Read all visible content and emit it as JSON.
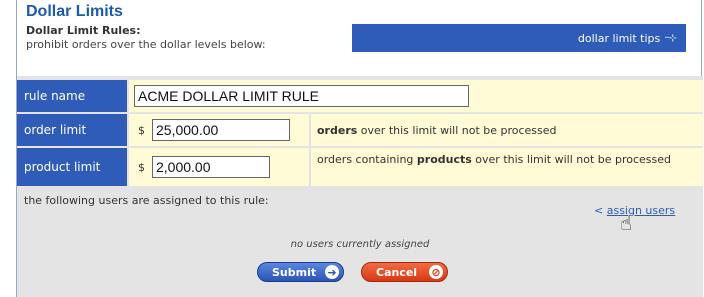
{
  "header": {
    "title": "Dollar Limits",
    "subtitle": "Dollar Limit Rules:",
    "description": "prohibit orders over the dollar levels below:",
    "tips_label": "dollar limit tips",
    "tips_icon": "dots-arrow-icon"
  },
  "form": {
    "rule_name": {
      "label": "rule name",
      "value": "ACME DOLLAR LIMIT RULE"
    },
    "order_limit": {
      "label": "order limit",
      "currency": "$",
      "value": "25,000.00",
      "note_bold": "orders",
      "note_rest": " over this limit will not be processed"
    },
    "product_limit": {
      "label": "product limit",
      "currency": "$",
      "value": "2,000.00",
      "note_pre": "orders containing ",
      "note_bold": "products",
      "note_rest": " over this limit will not be processed"
    }
  },
  "users": {
    "assigned_text": "the following users are assigned to this rule:",
    "assign_prefix": "< ",
    "assign_link": "assign users",
    "none_text": "no users currently assigned"
  },
  "buttons": {
    "submit": "Submit",
    "cancel": "Cancel"
  },
  "colors": {
    "label_bg": "#2f5cb8",
    "value_bg": "#fffbd6",
    "panel_bg": "#e4e4e4",
    "title": "#1e5aa8",
    "submit": "#2a55b5",
    "cancel": "#d93812"
  }
}
